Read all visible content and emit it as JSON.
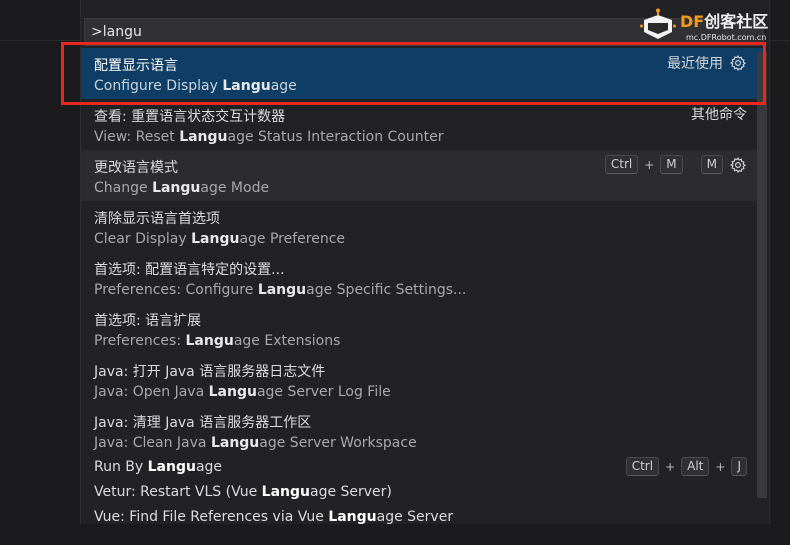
{
  "search": {
    "value": ">langu"
  },
  "items": [
    {
      "label_pre": "配置显示语言",
      "label_hl": "",
      "label_post": "",
      "detail_pre": "Configure Display ",
      "detail_hl": "Langu",
      "detail_post": "age",
      "badge": "最近使用",
      "state": "selected"
    },
    {
      "label_pre": "查看: 重置语言状态交互计数器",
      "label_hl": "",
      "label_post": "",
      "detail_pre": "View: Reset ",
      "detail_hl": "Langu",
      "detail_post": "age Status Interaction Counter",
      "badge": "其他命令"
    },
    {
      "label_pre": "更改语言模式",
      "label_hl": "",
      "label_post": "",
      "detail_pre": "Change ",
      "detail_hl": "Langu",
      "detail_post": "age Mode",
      "keys1": [
        "Ctrl",
        "M"
      ],
      "keys2": [
        "M"
      ],
      "state": "hovered"
    },
    {
      "label_pre": "清除显示语言首选项",
      "label_hl": "",
      "label_post": "",
      "detail_pre": "Clear Display ",
      "detail_hl": "Langu",
      "detail_post": "age Preference"
    },
    {
      "label_pre": "首选项: 配置语言特定的设置...",
      "label_hl": "",
      "label_post": "",
      "detail_pre": "Preferences: Configure ",
      "detail_hl": "Langu",
      "detail_post": "age Specific Settings..."
    },
    {
      "label_pre": "首选项: 语言扩展",
      "label_hl": "",
      "label_post": "",
      "detail_pre": "Preferences: ",
      "detail_hl": "Langu",
      "detail_post": "age Extensions"
    },
    {
      "label_pre": "Java: 打开 Java 语言服务器日志文件",
      "label_hl": "",
      "label_post": "",
      "detail_pre": "Java: Open Java ",
      "detail_hl": "Langu",
      "detail_post": "age Server Log File"
    },
    {
      "label_pre": "Java: 清理 Java 语言服务器工作区",
      "label_hl": "",
      "label_post": "",
      "detail_pre": "Java: Clean Java ",
      "detail_hl": "Langu",
      "detail_post": "age Server Workspace"
    },
    {
      "label_pre": "Run By ",
      "label_hl": "Langu",
      "label_post": "age",
      "keys1": [
        "Ctrl",
        "Alt",
        "J"
      ],
      "single": true
    },
    {
      "label_pre": "Vetur: Restart VLS (Vue ",
      "label_hl": "Langu",
      "label_post": "age Server)",
      "single": true
    },
    {
      "label_pre": "Vue: Find File References via Vue ",
      "label_hl": "Langu",
      "label_post": "age Server",
      "single": true
    }
  ],
  "watermark": {
    "brand_accent": "DF",
    "brand_text": "创客社区",
    "site": "mc.DFRobot.com.cn"
  },
  "colors": {
    "selection": "#0e3d66",
    "highlight_box": "#e8281e",
    "brand": "#f39a1e"
  }
}
